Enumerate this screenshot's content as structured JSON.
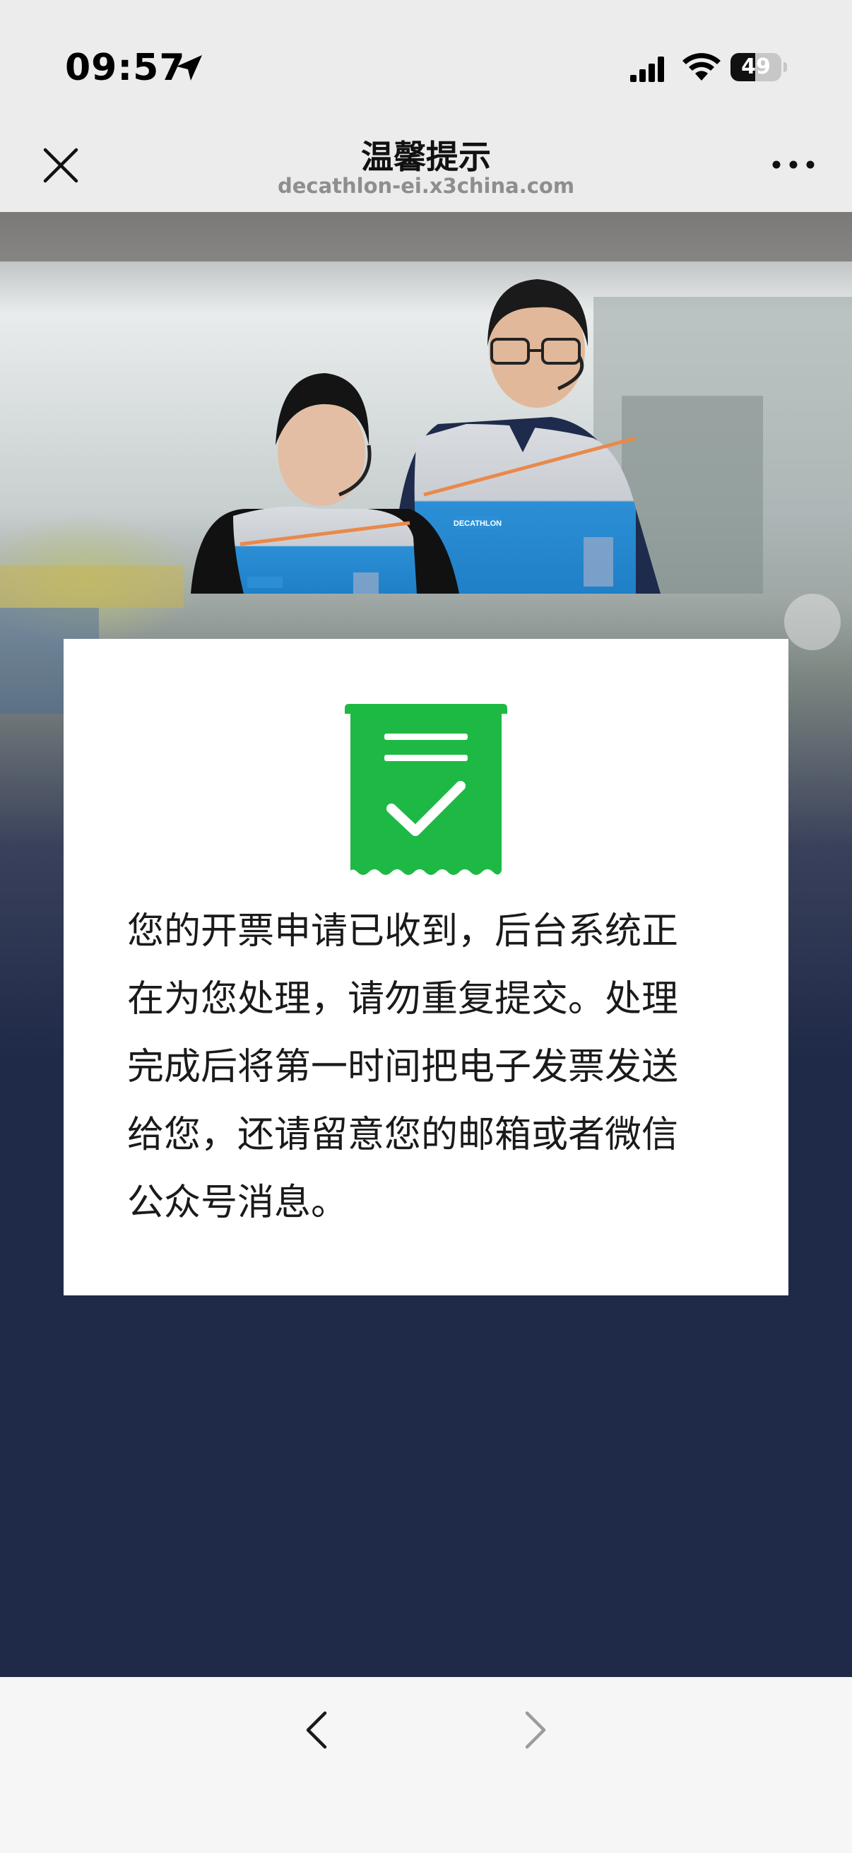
{
  "status_bar": {
    "time": "09:57",
    "battery_percent": 49,
    "icons": [
      "location-arrow-icon",
      "signal-icon",
      "wifi-icon",
      "battery-icon"
    ]
  },
  "nav_bar": {
    "title": "温馨提示",
    "url": "decathlon-ei.x3china.com",
    "icons": [
      "close-icon",
      "more-icon"
    ]
  },
  "banner": {
    "vest_logo_text": "DECATHLON"
  },
  "notice": {
    "icon": "receipt-check-icon",
    "icon_color": "#1eb944",
    "lines": [
      "您的开票申请已收到，后台系统正",
      "在为您处理，请勿重复提交。处理",
      "完成后将第一时间把电子发票发送",
      "给您，还请留意您的邮箱或者微信",
      "公众号消息。"
    ]
  },
  "toolbar": {
    "back_icon": "chevron-left-icon",
    "forward_icon": "chevron-right-icon",
    "forward_enabled": false
  },
  "colors": {
    "page_bg": "#ececec",
    "content_bg": "#1f2a48",
    "accent_green": "#1eb944",
    "decathlon_blue": "#2c8fd6"
  }
}
